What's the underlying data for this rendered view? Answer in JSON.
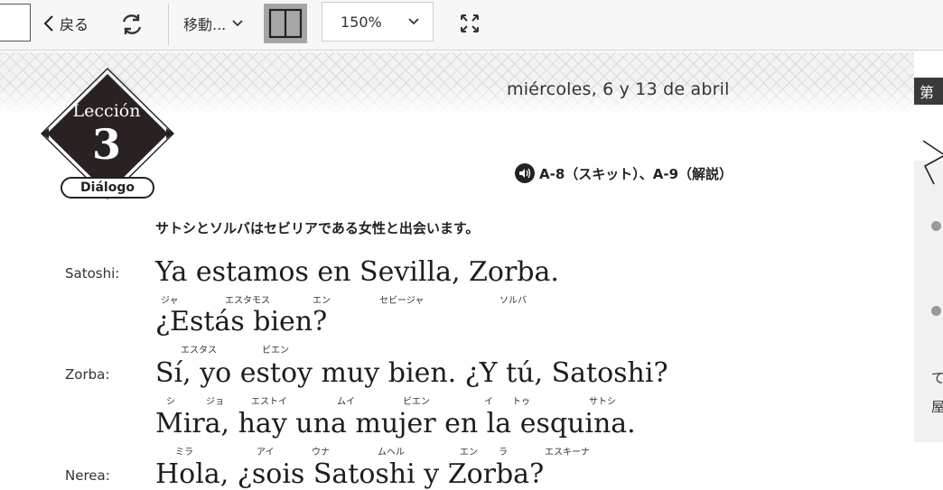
{
  "toolbar": {
    "back_label": "戻る",
    "move_label": "移動...",
    "zoom_value": "150%"
  },
  "header": {
    "date": "miércoles, 6 y 13 de abril",
    "right_tab": "第"
  },
  "lesson": {
    "label": "Lección",
    "number": "3",
    "section": "Diálogo"
  },
  "audio": {
    "label": "A-8（スキット）、A-9（解説）"
  },
  "intro": "サトシとソルバはセビリアである女性と出会います。",
  "dialogue": [
    {
      "speaker": "Satoshi:",
      "text": "Ya estamos en Sevilla, Zorba.",
      "ruby": [
        "ジャ",
        "エスタモス",
        "エン",
        "セビージャ",
        "ソルバ"
      ]
    },
    {
      "speaker": "",
      "text": "¿Estás bien?",
      "ruby": [
        "エスタス",
        "ビエン"
      ]
    },
    {
      "speaker": "Zorba:",
      "text": "Sí, yo estoy muy bien. ¿Y tú, Satoshi?",
      "ruby": [
        "シ",
        "ジョ",
        "エストイ",
        "ムイ",
        "ビエン",
        "イ",
        "トゥ",
        "サトシ"
      ]
    },
    {
      "speaker": "",
      "text": "Mira, hay una mujer en la esquina.",
      "ruby": [
        "ミラ",
        "アイ",
        "ウナ",
        "ムヘル",
        "エン",
        "ラ",
        "エスキーナ"
      ]
    },
    {
      "speaker": "Nerea:",
      "text": "Hola, ¿sois Satoshi y Zorba?",
      "ruby": []
    }
  ],
  "right_panel": {
    "lines": [
      "て",
      "屋"
    ]
  }
}
